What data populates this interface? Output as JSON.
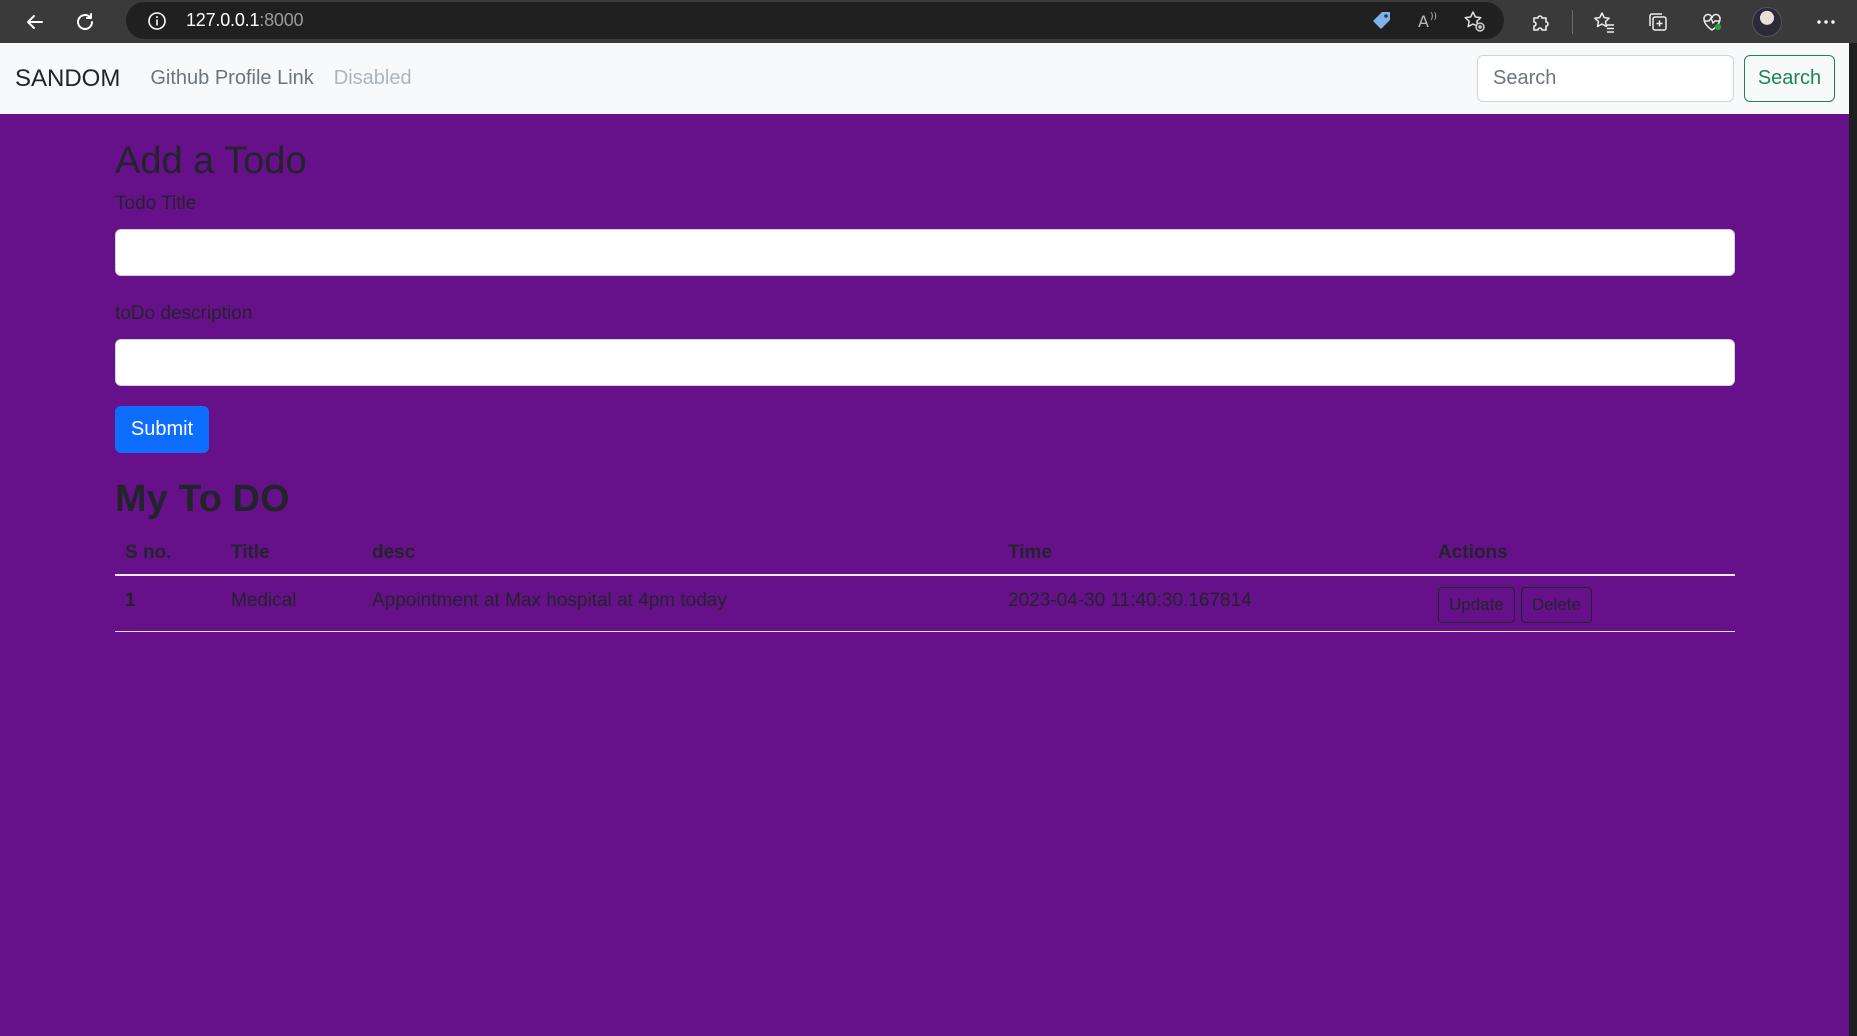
{
  "browser": {
    "url_host": "127.0.0.1",
    "url_port": ":8000",
    "icons": {
      "back": "arrow-left-icon",
      "reload": "reload-icon",
      "info": "info-icon",
      "tag": "tag-icon",
      "read_aloud": "read-aloud-icon",
      "favorite": "add-favorite-icon",
      "extensions": "puzzle-icon",
      "favorites": "favorites-list-icon",
      "collections": "collections-icon",
      "health": "heart-pulse-icon",
      "menu": "more-icon"
    }
  },
  "navbar": {
    "brand": "SANDOM",
    "links": [
      "Github Profile Link",
      "Disabled"
    ],
    "search_placeholder": "Search",
    "search_button": "Search"
  },
  "form": {
    "heading": "Add a Todo",
    "title_label": "Todo Title",
    "title_value": "",
    "desc_label": "toDo description",
    "desc_value": "",
    "submit_label": "Submit"
  },
  "list": {
    "heading": "My To DO",
    "columns": [
      "S no.",
      "Title",
      "desc",
      "Time",
      "Actions"
    ],
    "rows": [
      {
        "sno": "1",
        "title": "Medical",
        "desc": "Appointment at Max hospital at 4pm today",
        "time": "2023-04-30 11:40:30.167814",
        "update_label": "Update",
        "delete_label": "Delete"
      }
    ]
  },
  "colors": {
    "page_bg": "#66118a",
    "navbar_bg": "#f8f9fa",
    "primary": "#0d6efd",
    "success": "#198754"
  }
}
